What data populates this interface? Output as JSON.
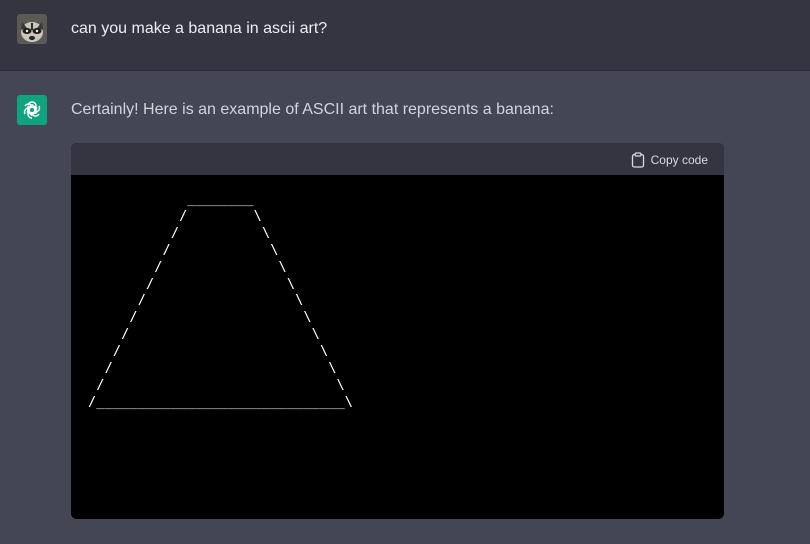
{
  "user_message": {
    "avatar": "raccoon-avatar",
    "text": "can you make a banana in ascii art?"
  },
  "assistant_message": {
    "avatar": "openai-logo-icon",
    "avatar_color": "#10a37f",
    "text": "Certainly! Here is an example of ASCII art that represents a banana:",
    "code_block": {
      "copy_label": "Copy code",
      "copy_icon": "clipboard-icon",
      "content": "            ________\n           /        \\\n          /          \\\n         /            \\\n        /              \\\n       /                \\\n      /                  \\\n     /                    \\\n    /                      \\\n   /                        \\\n  /                          \\\n /                            \\\n/______________________________\\"
    }
  },
  "colors": {
    "user_row_bg": "#343541",
    "assistant_row_bg": "#444654",
    "code_bg": "#000000",
    "code_header_bg": "#343541"
  }
}
